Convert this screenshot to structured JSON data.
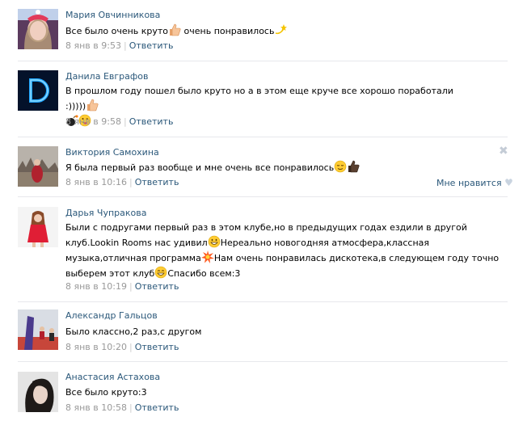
{
  "comments": [
    {
      "author": "Мария Овчинникова",
      "text": "Все было очень круто",
      "text2": " очень понравилось",
      "date": "8 янв в 9:53",
      "reply": "Ответить"
    },
    {
      "author": "Данила Евграфов",
      "text": "В прошлом году пошел было круто но а в этом еще круче все хорошо поработали :)))))",
      "date": "8 янв в 9:58",
      "reply": "Ответить"
    },
    {
      "author": "Виктория Самохина",
      "text": "Я была первый раз вообще и мне очень все понравилось",
      "date": "8 янв в 10:16",
      "reply": "Ответить",
      "like": "Мне нравится"
    },
    {
      "author": "Дарья Чупракова",
      "line1": "Были с подругами первый раз в этом клубе,но в предыдущих годах ездили в другой",
      "line2a": "клуб.Lookin Rooms нас удивил",
      "line2b": "Нереально новогодняя атмосфера,классная",
      "line3a": "музыка,отличная программа",
      "line3b": "Нам очень понравилась дискотека,в следующем году точно",
      "line4a": "выберем этот клуб",
      "line4b": "Спасибо всем:3",
      "date": "8 янв в 10:19",
      "reply": "Ответить"
    },
    {
      "author": "Александр Гальцов",
      "text": "Было классно,2 раз,с другом",
      "date": "8 янв в 10:20",
      "reply": "Ответить"
    },
    {
      "author": "Анастасия Астахова",
      "text": "Все было круто:3",
      "date": "8 янв в 10:58",
      "reply": "Ответить"
    }
  ],
  "icons": {
    "close": "close-icon",
    "heart": "heart-icon"
  }
}
